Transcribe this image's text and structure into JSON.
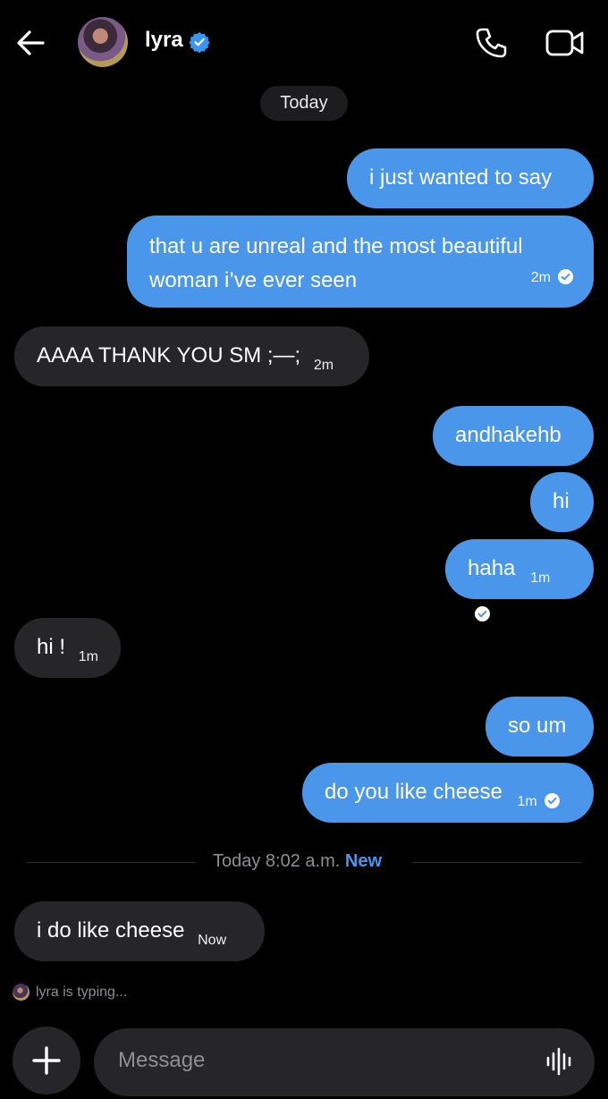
{
  "header": {
    "contact_name": "lyra",
    "verified": true
  },
  "date_pill": "Today",
  "messages": [
    {
      "dir": "out",
      "text": "i just wanted to say",
      "time": "",
      "read": false
    },
    {
      "dir": "out",
      "text": "that u are unreal and the most beautiful woman i’ve ever seen",
      "time": "2m",
      "read": true
    },
    {
      "dir": "in",
      "text": "AAAA THANK YOU SM ;—;",
      "time": "2m"
    },
    {
      "dir": "out",
      "text": "andhakehb",
      "time": "",
      "read": false
    },
    {
      "dir": "out",
      "text": "hi",
      "time": "",
      "read": false
    },
    {
      "dir": "out",
      "text": "haha",
      "time": "1m",
      "read": true
    },
    {
      "dir": "in",
      "text": "hi !",
      "time": "1m"
    },
    {
      "dir": "out",
      "text": "so um",
      "time": "",
      "read": false
    },
    {
      "dir": "out",
      "text": "do you like cheese",
      "time": "1m",
      "read": true
    },
    {
      "dir": "in",
      "text": "i do like cheese",
      "time": "Now"
    }
  ],
  "divider": {
    "label": "Today 8:02 a.m.",
    "new_label": "New"
  },
  "typing_indicator": "lyra is typing...",
  "composer": {
    "placeholder": "Message"
  },
  "colors": {
    "accent": "#4a96ea",
    "incoming_bubble": "#262629",
    "background": "#000000"
  },
  "icons": [
    "back-arrow-icon",
    "verified-badge-icon",
    "phone-icon",
    "video-camera-icon",
    "check-circle-icon",
    "plus-icon",
    "audio-waveform-icon"
  ]
}
